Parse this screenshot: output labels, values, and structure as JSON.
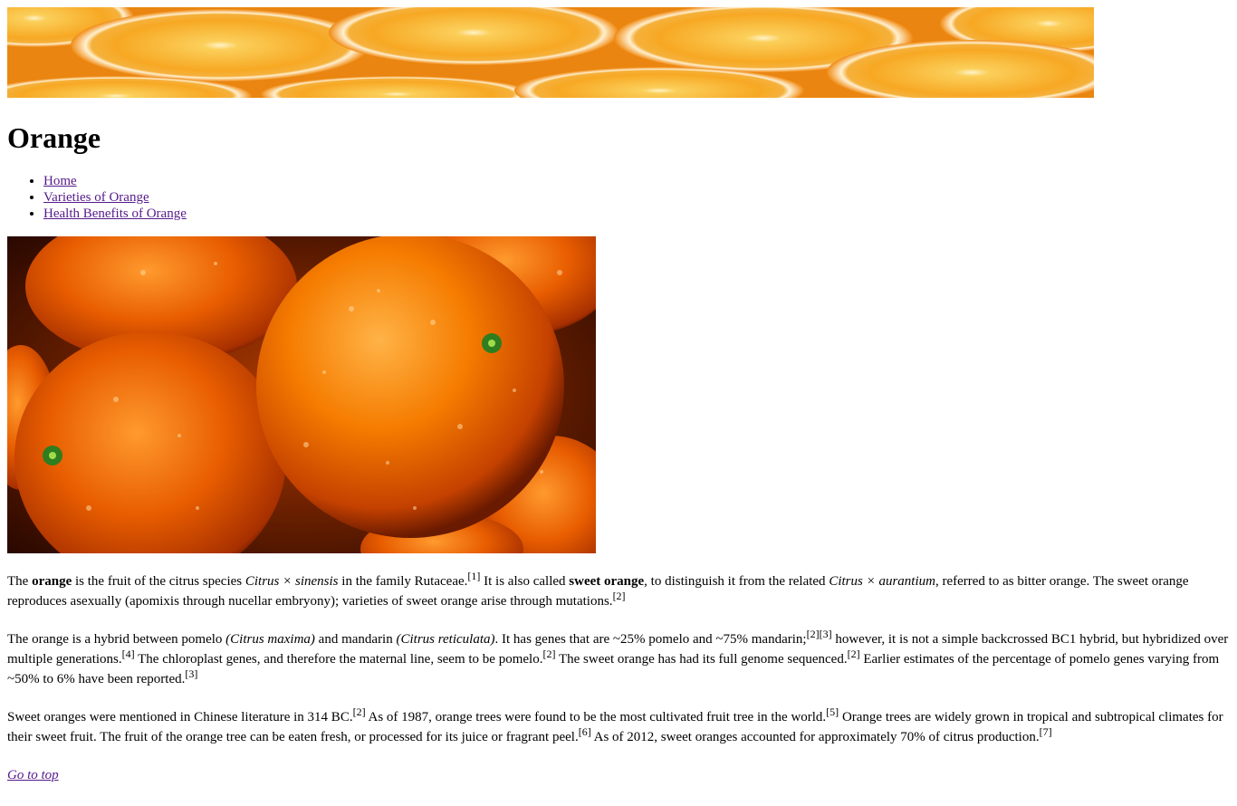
{
  "page": {
    "title": "Orange",
    "banner_alt": "orange-slices-banner",
    "photo_alt": "oranges-photo"
  },
  "nav": {
    "items": [
      {
        "label": "Home"
      },
      {
        "label": "Varieties of Orange"
      },
      {
        "label": "Health Benefits of Orange"
      }
    ]
  },
  "content": {
    "p1": {
      "t1": "The ",
      "b1": "orange",
      "t2": " is the fruit of the citrus species ",
      "i1": "Citrus × sinensis",
      "t3": " in the family Rutaceae.",
      "r1": "[1]",
      "t4": " It is also called ",
      "b2": "sweet orange",
      "t5": ", to distinguish it from the related ",
      "i2": "Citrus × aurantium",
      "t6": ", referred to as bitter orange. The sweet orange reproduces asexually (apomixis through nucellar embryony); varieties of sweet orange arise through mutations.",
      "r2": "[2]"
    },
    "p2": {
      "t1": "The orange is a hybrid between pomelo ",
      "i1": "(Citrus maxima)",
      "t2": " and mandarin ",
      "i2": "(Citrus reticulata)",
      "t3": ". It has genes that are ~25% pomelo and ~75% mandarin;",
      "r1": "[2]",
      "r2": "[3]",
      "t4": " however, it is not a simple backcrossed BC1 hybrid, but hybridized over multiple generations.",
      "r3": "[4]",
      "t5": " The chloroplast genes, and therefore the maternal line, seem to be pomelo.",
      "r4": "[2]",
      "t6": " The sweet orange has had its full genome sequenced.",
      "r5": "[2]",
      "t7": " Earlier estimates of the percentage of pomelo genes varying from ~50% to 6% have been reported.",
      "r6": "[3]"
    },
    "p3": {
      "t1": "Sweet oranges were mentioned in Chinese literature in 314 BC.",
      "r1": "[2]",
      "t2": " As of 1987, orange trees were found to be the most cultivated fruit tree in the world.",
      "r2": "[5]",
      "t3": " Orange trees are widely grown in tropical and subtropical climates for their sweet fruit. The fruit of the orange tree can be eaten fresh, or processed for its juice or fragrant peel.",
      "r3": "[6]",
      "t4": " As of 2012, sweet oranges accounted for approximately 70% of citrus production.",
      "r4": "[7]"
    },
    "go_top": "Go to top"
  },
  "colors": {
    "link": "#551a8b",
    "orange_light": "#f7b53b",
    "orange_mid": "#ef8c12",
    "orange_dark": "#c24a00"
  }
}
